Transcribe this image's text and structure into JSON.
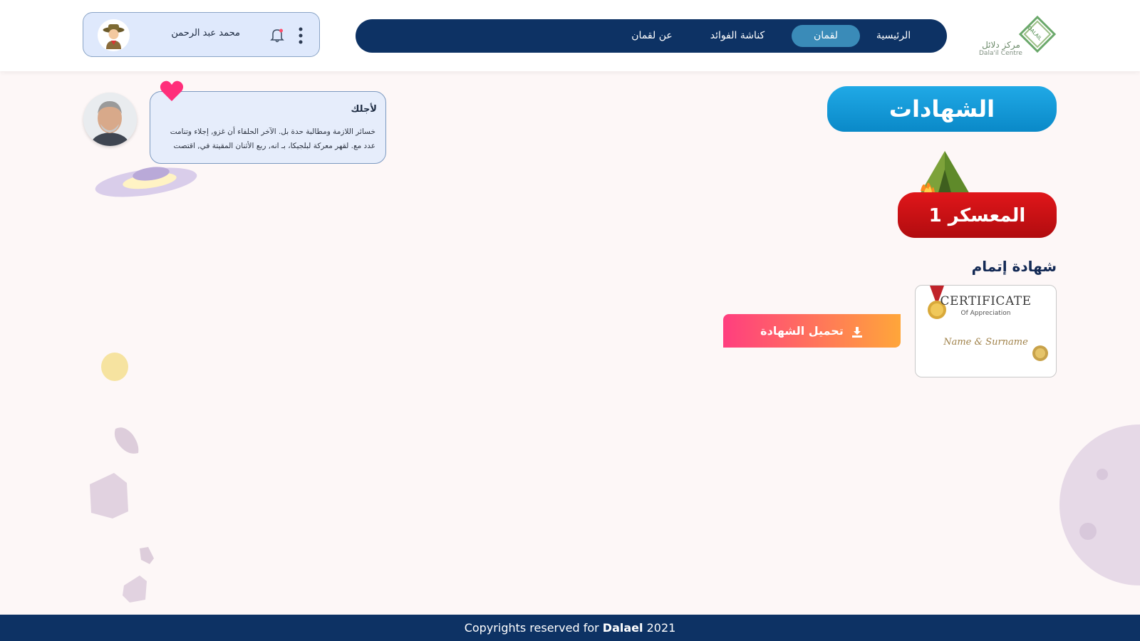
{
  "header": {
    "logo": {
      "text_ar": "مركز دلائل",
      "text_en": "Dala'il Centre",
      "mark": "DALAIL"
    },
    "nav": [
      {
        "label": "الرئيسية",
        "active": false
      },
      {
        "label": "لقمان",
        "active": true
      },
      {
        "label": "كناشة الفوائد",
        "active": false
      },
      {
        "label": "عن لقمان",
        "active": false
      }
    ],
    "user": {
      "name": "محمد عبد الرحمن",
      "avatar_icon": "scout-avatar-icon"
    },
    "icons": {
      "bell": "bell-icon",
      "menu": "kebab-menu-icon"
    }
  },
  "page": {
    "title": "الشهادات",
    "camp": {
      "label": "المعسكر 1",
      "icon": "tent-campfire-icon"
    },
    "certificate": {
      "heading": "شهادة إتمام",
      "thumb_title": "CERTIFICATE",
      "thumb_subtitle": "Of Appreciation",
      "thumb_name": "Name & Surname",
      "download_label": "تحميل الشهادة",
      "download_icon": "download-icon"
    }
  },
  "message": {
    "title": "لأجلك",
    "text": "خسائر اللازمة ومطالبة حدة بل. الآخر الحلفاء أن غزو, إجلاء وتنامت عدد مع. لقهر معركة لبلجيكا، بـ انه, ربع الأثنان المقيتة في, اقتصت"
  },
  "footer": {
    "prefix": "Copyrights reserved for",
    "brand": "Dalael",
    "year": "2021"
  },
  "colors": {
    "navy": "#0d3264",
    "active_tab": "#3a8bb8",
    "title_blue": "#0a89c8",
    "camp_red": "#d3121a",
    "btn_pink": "#ff3e7f",
    "btn_orange": "#ffa63a"
  }
}
